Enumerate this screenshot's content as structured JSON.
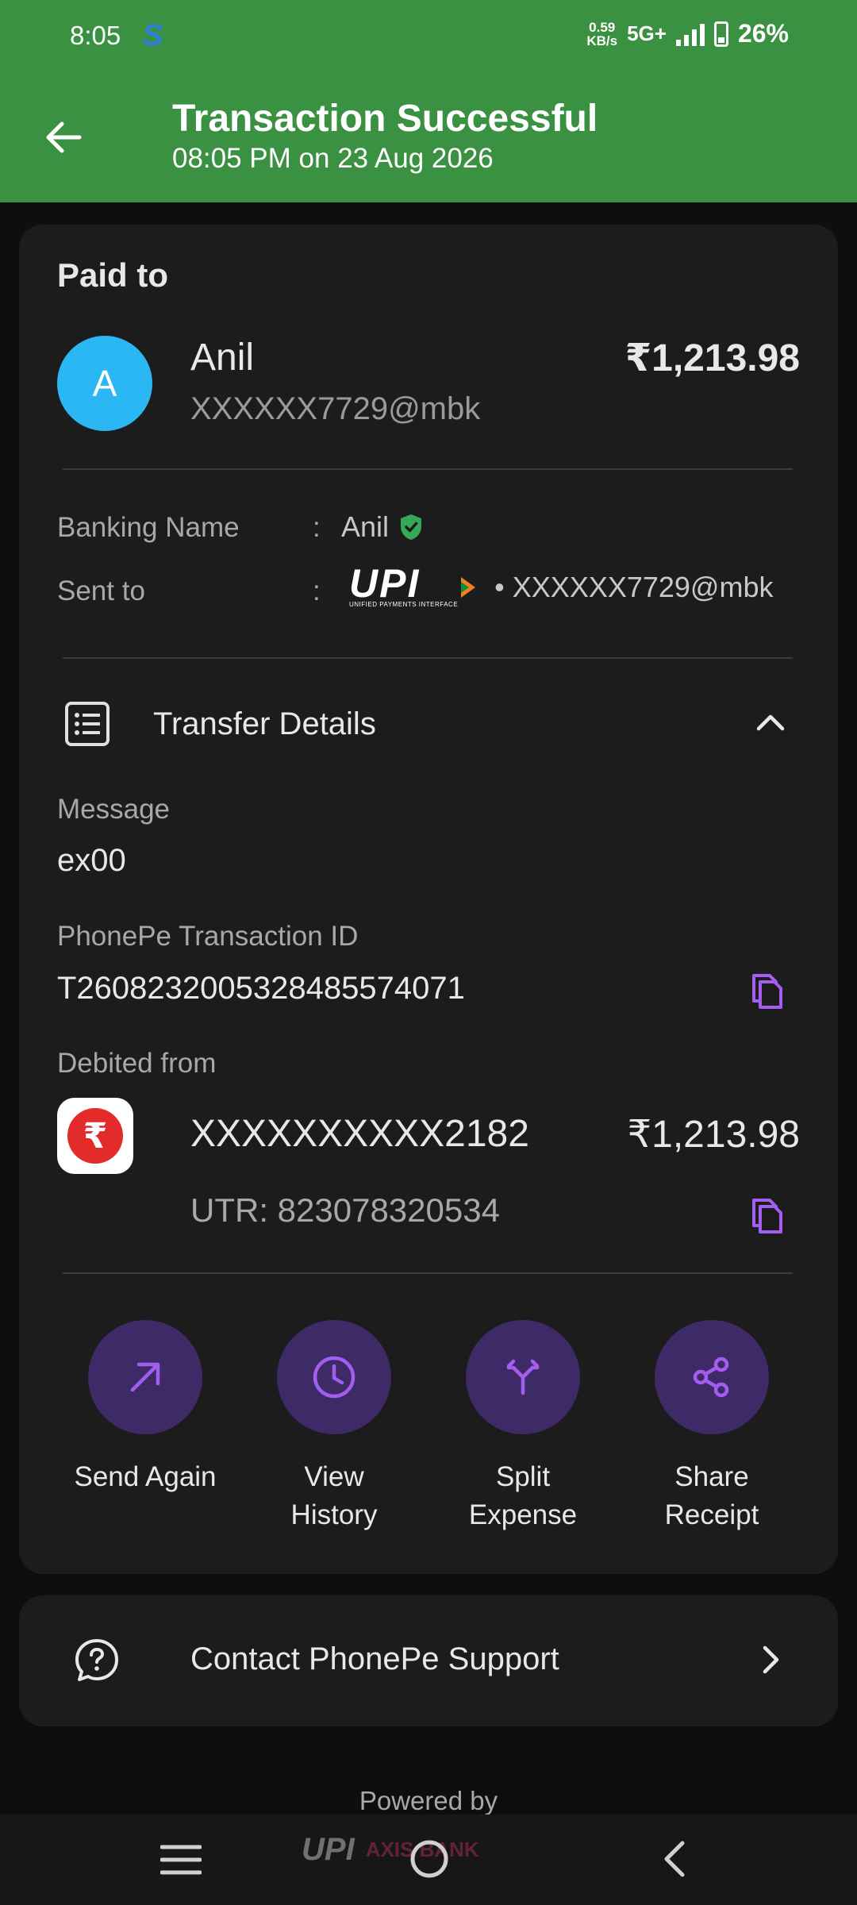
{
  "status_bar": {
    "time": "8:05",
    "app_icon": "S",
    "net_speed_value": "0.59",
    "net_speed_unit": "KB/s",
    "network": "5G+",
    "battery": "26%"
  },
  "header": {
    "title": "Transaction Successful",
    "subtitle": "08:05 PM on 23 Aug 2026",
    "bg_color": "#3a9142"
  },
  "paid_to": {
    "label": "Paid to",
    "avatar_letter": "A",
    "name": "Anil",
    "vpa": "XXXXXX7729@mbk",
    "amount": "₹1,213.98"
  },
  "details": {
    "banking_name_label": "Banking Name",
    "banking_name_value": "Anil",
    "sent_to_label": "Sent to",
    "sent_to_logo_text": "UPI",
    "sent_to_logo_subtext": "UNIFIED PAYMENTS INTERFACE",
    "sent_to_value": "• XXXXXX7729@mbk",
    "colon": ":"
  },
  "transfer": {
    "title": "Transfer Details",
    "message_label": "Message",
    "message_value": "ex00",
    "txn_id_label": "PhonePe Transaction ID",
    "txn_id_value": "T2608232005328485574071",
    "debited_label": "Debited from",
    "bank_logo_letter": "₹",
    "account": "XXXXXXXXXX2182",
    "account_amount": "₹1,213.98",
    "utr": "UTR: 823078320534"
  },
  "actions": [
    {
      "label": "Send Again",
      "icon": "arrow-up-right-icon"
    },
    {
      "label": "View\nHistory",
      "icon": "clock-icon"
    },
    {
      "label": "Split\nExpense",
      "icon": "split-icon"
    },
    {
      "label": "Share\nReceipt",
      "icon": "share-icon"
    }
  ],
  "support": {
    "label": "Contact PhonePe Support"
  },
  "footer": {
    "powered_by": "Powered by",
    "upi_text": "UPI",
    "bank_text": "AXIS BANK"
  },
  "colors": {
    "accent_purple": "#a35ef0",
    "action_bg": "#3d2a66",
    "verified_green": "#34a853"
  }
}
